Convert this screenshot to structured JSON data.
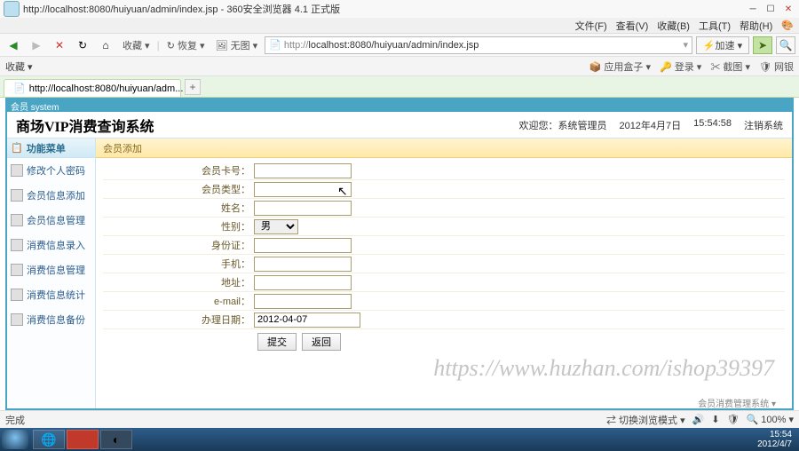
{
  "browser": {
    "title_url": "http://localhost:8080/huiyuan/admin/index.jsp",
    "title_suffix": " - 360安全浏览器 4.1 正式版",
    "menu": {
      "file": "文件(F)",
      "view": "查看(V)",
      "fav": "收藏(B)",
      "tools": "工具(T)",
      "help": "帮助(H)"
    },
    "fav_label": "收藏 ▾",
    "restore": "↻ 恢复 ▾",
    "nopic": "🖼 无图 ▾",
    "address_prefix": "http://",
    "address_rest": "localhost:8080/huiyuan/admin/index.jsp",
    "accel": "⚡加速 ▾",
    "fav_strip_left": "收藏 ▾",
    "fav_strip": {
      "appbox": "📦 应用盒子 ▾",
      "login": "🔑 登录 ▾",
      "screenshot": "✂ 截图 ▾",
      "netbank": "🛡 网银"
    },
    "tab_label": "http://localhost:8080/huiyuan/adm..."
  },
  "frame_title": "会员 system",
  "app": {
    "title": "商场VIP消费查询系统",
    "welcome": "欢迎您：系统管理员",
    "date": "2012年4月7日",
    "time": "15:54:58",
    "logout": "注销系统"
  },
  "sidebar": {
    "head": "功能菜单",
    "items": [
      {
        "label": "修改个人密码"
      },
      {
        "label": "会员信息添加"
      },
      {
        "label": "会员信息管理"
      },
      {
        "label": "消费信息录入"
      },
      {
        "label": "消费信息管理"
      },
      {
        "label": "消费信息统计"
      },
      {
        "label": "消费信息备份"
      }
    ]
  },
  "content": {
    "title": "会员添加",
    "fields": {
      "card_no": "会员卡号：",
      "card_type": "会员类型：",
      "name": "姓名：",
      "gender": "性别：",
      "gender_value": "男",
      "id_card": "身份证：",
      "phone": "手机：",
      "address": "地址：",
      "email": "e-mail：",
      "proc_date": "办理日期：",
      "proc_date_value": "2012-04-07"
    },
    "buttons": {
      "submit": "提交",
      "back": "返回"
    }
  },
  "watermark": "https://www.huzhan.com/ishop39397",
  "footer": "会员消费管理系统 ▾",
  "status": {
    "done": "完成",
    "mode": "⇄ 切换浏览模式 ▾",
    "zoom": "🔍 100% ▾"
  },
  "taskbar": {
    "time": "15:54",
    "date": "2012/4/7"
  }
}
